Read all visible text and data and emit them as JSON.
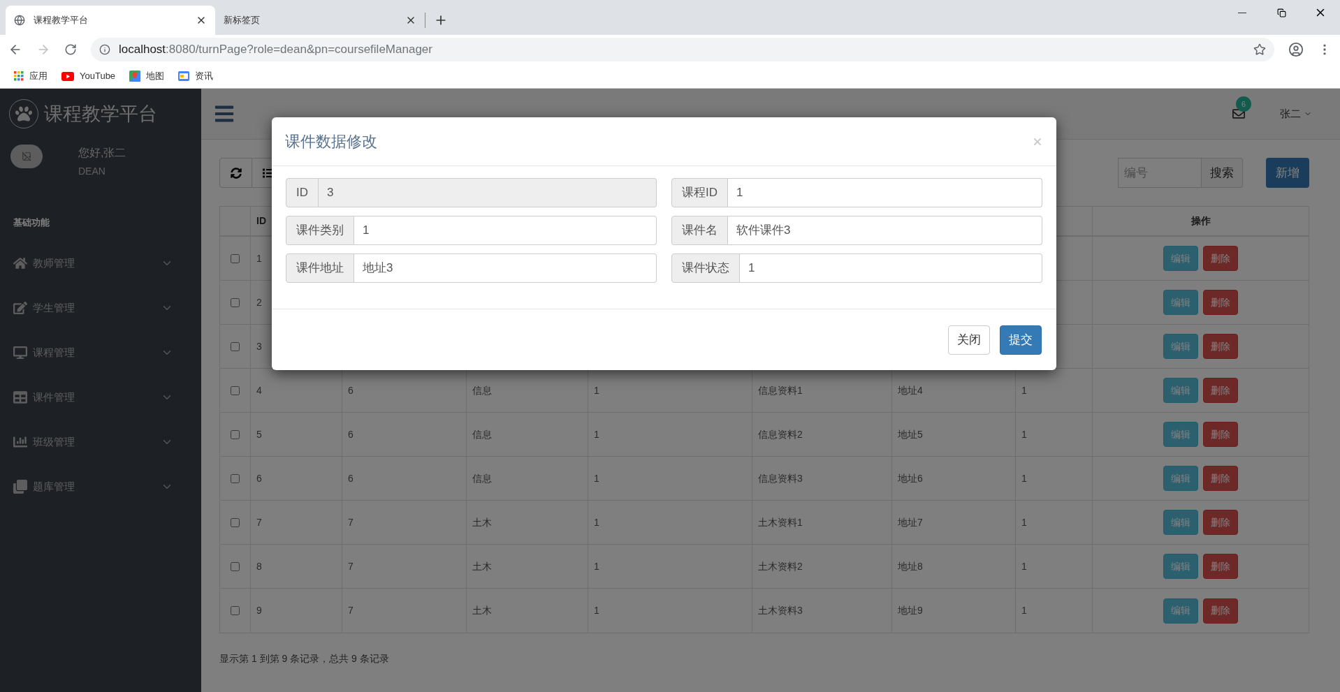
{
  "browser": {
    "tabs": [
      {
        "title": "课程教学平台",
        "selected": true
      },
      {
        "title": "新标签页",
        "selected": false
      }
    ],
    "address": {
      "host": "localhost",
      "path": ":8080/turnPage?role=dean&pn=coursefileManager"
    },
    "bookmarks": [
      {
        "label": "应用",
        "kind": "apps"
      },
      {
        "label": "YouTube",
        "kind": "youtube"
      },
      {
        "label": "地图",
        "kind": "maps"
      },
      {
        "label": "资讯",
        "kind": "news"
      }
    ]
  },
  "sidebar": {
    "brand": "课程教学平台",
    "greeting": "您好,张二",
    "role": "DEAN",
    "section": "基础功能",
    "items": [
      {
        "label": "教师管理",
        "expanded": false
      },
      {
        "label": "学生管理",
        "expanded": false
      },
      {
        "label": "课程管理",
        "expanded": false
      },
      {
        "label": "课件管理",
        "expanded": false
      },
      {
        "label": "班级管理",
        "expanded": false
      },
      {
        "label": "题库管理",
        "expanded": false
      }
    ]
  },
  "header": {
    "mail_count": "6",
    "user": "张二"
  },
  "toolbar": {
    "search_placeholder": "编号",
    "search_button": "搜索",
    "add_button": "新增"
  },
  "table": {
    "columns": [
      "ID",
      "操作"
    ],
    "rows": [
      {
        "checked": false,
        "cells": [
          "1"
        ],
        "actions": [
          "编辑",
          "删除"
        ]
      },
      {
        "checked": false,
        "cells": [
          "2"
        ],
        "actions": [
          "编辑",
          "删除"
        ]
      },
      {
        "checked": false,
        "cells": [
          "3"
        ],
        "actions": [
          "编辑",
          "删除"
        ]
      },
      {
        "checked": false,
        "cells": [
          "4",
          "6",
          "信息",
          "1",
          "信息资料1",
          "地址4",
          "1"
        ],
        "actions": [
          "编辑",
          "删除"
        ]
      },
      {
        "checked": false,
        "cells": [
          "5",
          "6",
          "信息",
          "1",
          "信息资料2",
          "地址5",
          "1"
        ],
        "actions": [
          "编辑",
          "删除"
        ]
      },
      {
        "checked": false,
        "cells": [
          "6",
          "6",
          "信息",
          "1",
          "信息资料3",
          "地址6",
          "1"
        ],
        "actions": [
          "编辑",
          "删除"
        ]
      },
      {
        "checked": false,
        "cells": [
          "7",
          "7",
          "土木",
          "1",
          "土木资料1",
          "地址7",
          "1"
        ],
        "actions": [
          "编辑",
          "删除"
        ]
      },
      {
        "checked": false,
        "cells": [
          "8",
          "7",
          "土木",
          "1",
          "土木资料2",
          "地址8",
          "1"
        ],
        "actions": [
          "编辑",
          "删除"
        ]
      },
      {
        "checked": false,
        "cells": [
          "9",
          "7",
          "土木",
          "1",
          "土木资料3",
          "地址9",
          "1"
        ],
        "actions": [
          "编辑",
          "删除"
        ]
      }
    ]
  },
  "footer": "显示第 1 到第 9 条记录，总共 9 条记录",
  "modal": {
    "title": "课件数据修改",
    "fields": [
      {
        "label": "ID",
        "value": "3",
        "disabled": true
      },
      {
        "label": "课程ID",
        "value": "1",
        "disabled": false
      },
      {
        "label": "课件类别",
        "value": "1",
        "disabled": false
      },
      {
        "label": "课件名",
        "value": "软件课件3",
        "disabled": false
      },
      {
        "label": "课件地址",
        "value": "地址3",
        "disabled": false
      },
      {
        "label": "课件状态",
        "value": "1",
        "disabled": false
      }
    ],
    "buttons": [
      {
        "label": "关闭",
        "kind": "default"
      },
      {
        "label": "提交",
        "kind": "primary"
      }
    ]
  }
}
